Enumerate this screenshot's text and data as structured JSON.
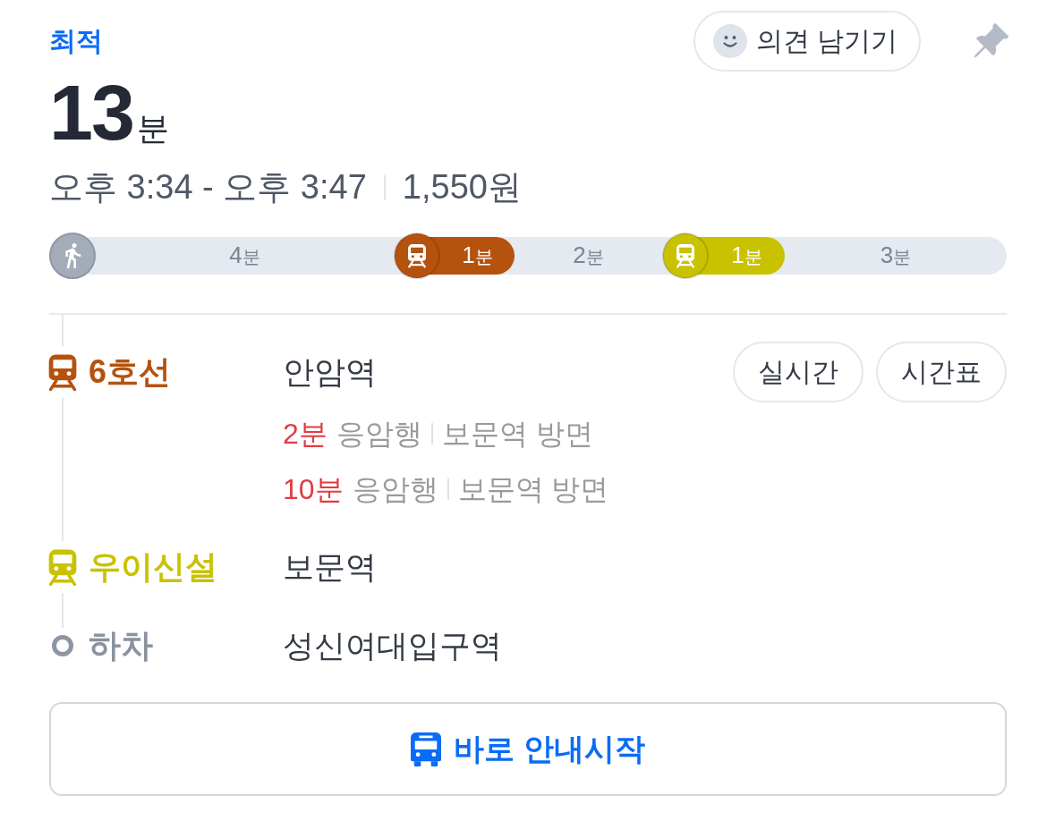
{
  "route": {
    "badge": "최적",
    "duration": {
      "value": "13",
      "unit": "분"
    },
    "time_range": "오후 3:34 - 오후 3:47",
    "fare": "1,550원"
  },
  "feedback_button": {
    "label": "의견 남기기"
  },
  "segments": [
    {
      "kind": "walk",
      "value": "4",
      "unit": "분"
    },
    {
      "kind": "subway",
      "value": "1",
      "unit": "분",
      "color": "#b5520e"
    },
    {
      "kind": "walk",
      "value": "2",
      "unit": "분"
    },
    {
      "kind": "subway",
      "value": "1",
      "unit": "분",
      "color": "#c8c200"
    },
    {
      "kind": "walk",
      "value": "3",
      "unit": "분"
    }
  ],
  "legs": [
    {
      "kind": "board",
      "line": "6호선",
      "color": "#b5520e",
      "station": "안암역",
      "buttons": [
        "실시간",
        "시간표"
      ],
      "arrivals": [
        {
          "wait": "2분",
          "destination": "응암행",
          "direction": "보문역 방면"
        },
        {
          "wait": "10분",
          "destination": "응암행",
          "direction": "보문역 방면"
        }
      ]
    },
    {
      "kind": "board",
      "line": "우이신설",
      "color": "#c8c200",
      "station": "보문역"
    },
    {
      "kind": "alight",
      "line": "하차",
      "station": "성신여대입구역"
    }
  ],
  "start_button": {
    "label": "바로 안내시작"
  }
}
